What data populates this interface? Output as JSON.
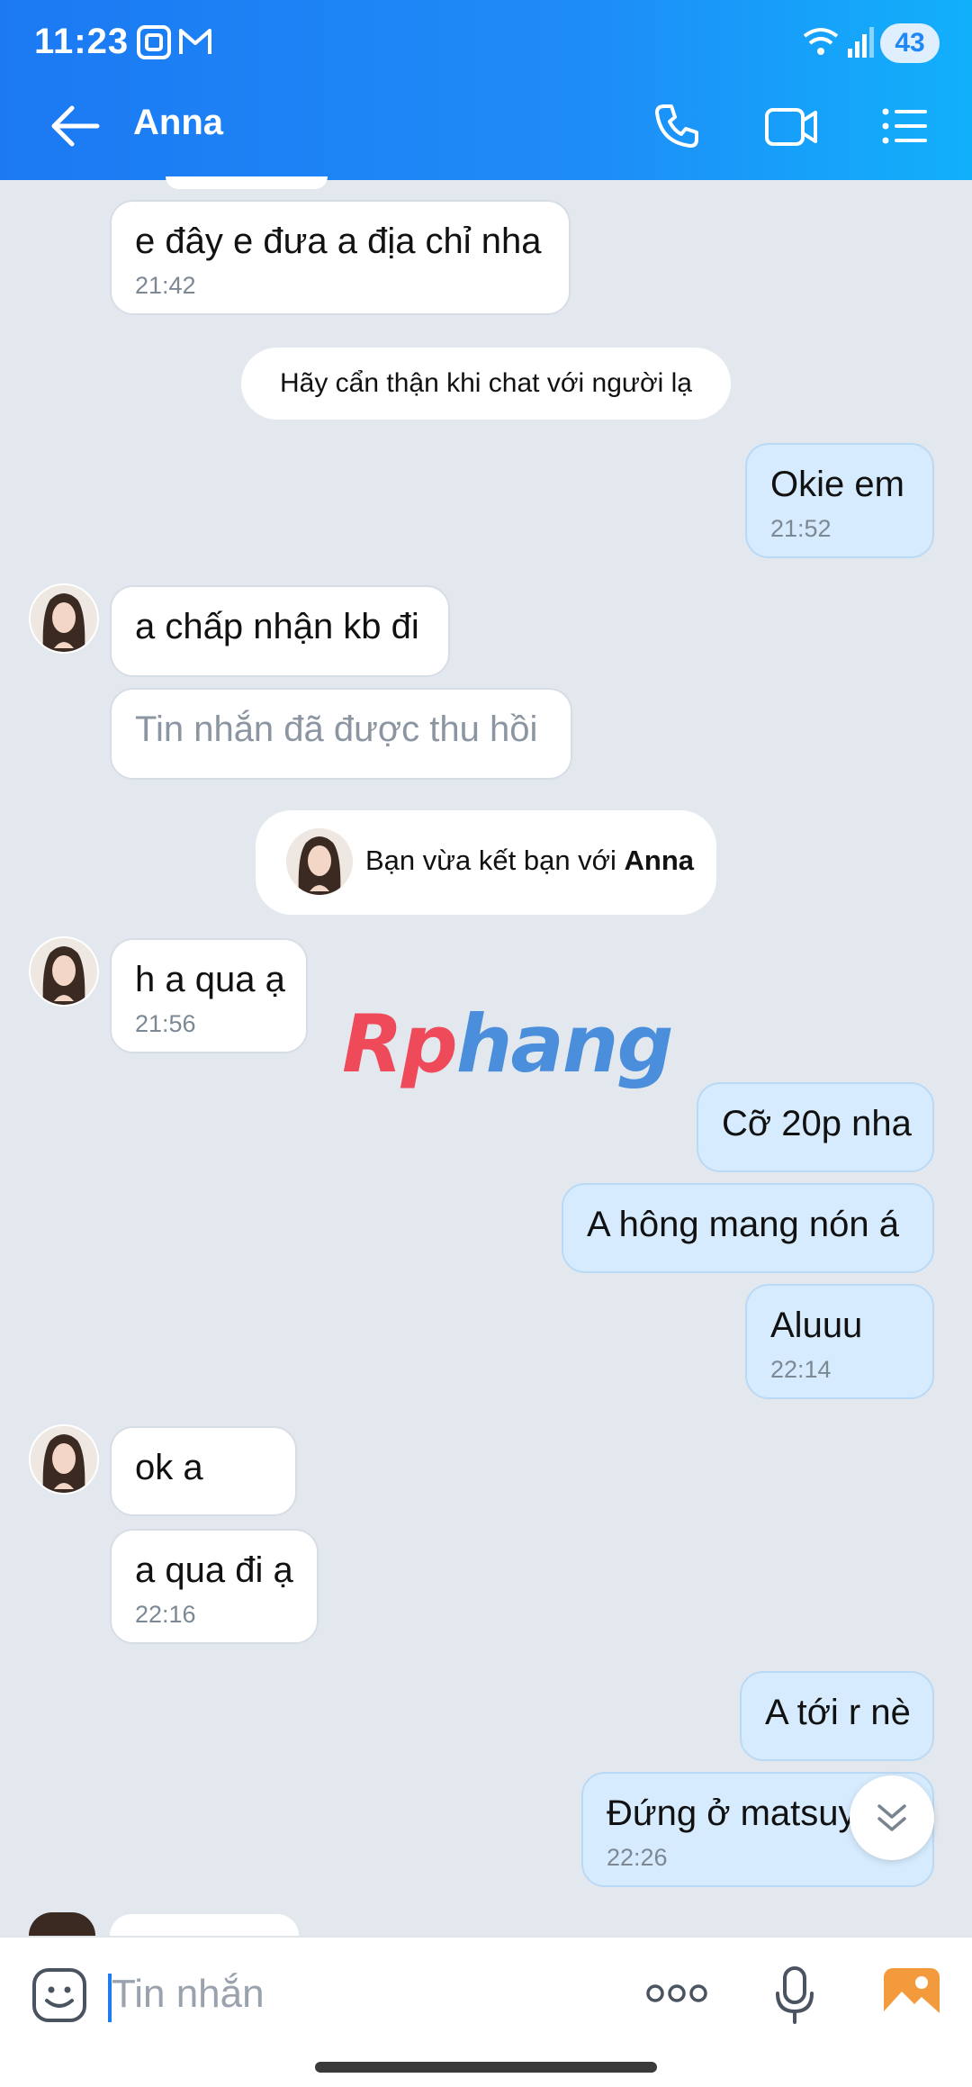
{
  "status_bar": {
    "time": "11:23",
    "battery": "43"
  },
  "header": {
    "title": "Anna"
  },
  "messages": {
    "m1": {
      "text": "e đây e đưa a địa chỉ nha",
      "time": "21:42"
    },
    "warning": "Hãy cẩn thận khi chat với người lạ",
    "m2": {
      "text": "Okie em",
      "time": "21:52"
    },
    "m3": {
      "text": "a chấp nhận kb đi"
    },
    "m4": {
      "text": "Tin nhắn đã được thu hồi"
    },
    "friend_notice": {
      "prefix": "Bạn vừa kết bạn với ",
      "name": "Anna"
    },
    "m5": {
      "text": "h a qua ạ",
      "time": "21:56"
    },
    "m6": {
      "text": "Cỡ 20p nha"
    },
    "m7": {
      "text": "A hông mang nón á"
    },
    "m8": {
      "text": "Aluuu",
      "time": "22:14"
    },
    "m9": {
      "text": "ok a"
    },
    "m10": {
      "text": "a qua đi ạ",
      "time": "22:16"
    },
    "m11": {
      "text": "A tới r nè"
    },
    "m12": {
      "text": "Đứng ở matsuy",
      "time": "22:26"
    }
  },
  "watermark": {
    "part1": "Rp",
    "part2": "hang"
  },
  "composer": {
    "placeholder": "Tin nhắn"
  },
  "icons": [
    "back-arrow-icon",
    "phone-icon",
    "video-call-icon",
    "list-menu-icon",
    "emoji-icon",
    "more-dots-icon",
    "microphone-icon",
    "gallery-icon",
    "chevron-double-down-icon"
  ],
  "colors": {
    "header_start": "#1c79f2",
    "header_end": "#11b0fb",
    "my_bubble": "#d6ecfe",
    "background": "#e3e8ef"
  }
}
